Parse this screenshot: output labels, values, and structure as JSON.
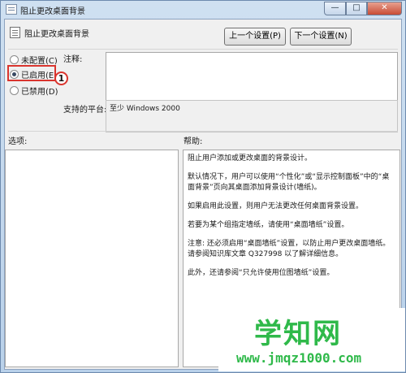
{
  "window": {
    "title": "阻止更改桌面背景",
    "minimize": "—",
    "maximize": "□",
    "close": "✕"
  },
  "header": {
    "title": "阻止更改桌面背景",
    "prev_label": "上一个设置(P)",
    "next_label": "下一个设置(N)"
  },
  "radios": [
    {
      "label": "未配置(C)",
      "checked": false
    },
    {
      "label": "已启用(E)",
      "checked": true
    },
    {
      "label": "已禁用(D)",
      "checked": false
    }
  ],
  "callout": "1",
  "comment": {
    "label": "注释:",
    "value": ""
  },
  "platform": {
    "label": "支持的平台:",
    "value": "至少 Windows 2000"
  },
  "options_label": "选项:",
  "help_label": "帮助:",
  "help_paragraphs": [
    "阻止用户添加或更改桌面的背景设计。",
    "默认情况下，用户可以使用“个性化”或“显示控制面板”中的“桌面背景”页向其桌面添加背景设计(墙纸)。",
    "如果启用此设置，则用户无法更改任何桌面背景设置。",
    "若要为某个组指定墙纸，请使用“桌面墙纸”设置。",
    "注意: 还必须启用“桌面墙纸”设置，以防止用户更改桌面墙纸。请参阅知识库文章 Q327998 以了解详细信息。",
    "此外，还请参阅“只允许使用位图墙纸”设置。"
  ],
  "watermark": {
    "main": "学知网",
    "url": "www.jmqz1000.com"
  },
  "colors": {
    "highlight": "#d9352e",
    "watermark": "#2fb94a"
  }
}
